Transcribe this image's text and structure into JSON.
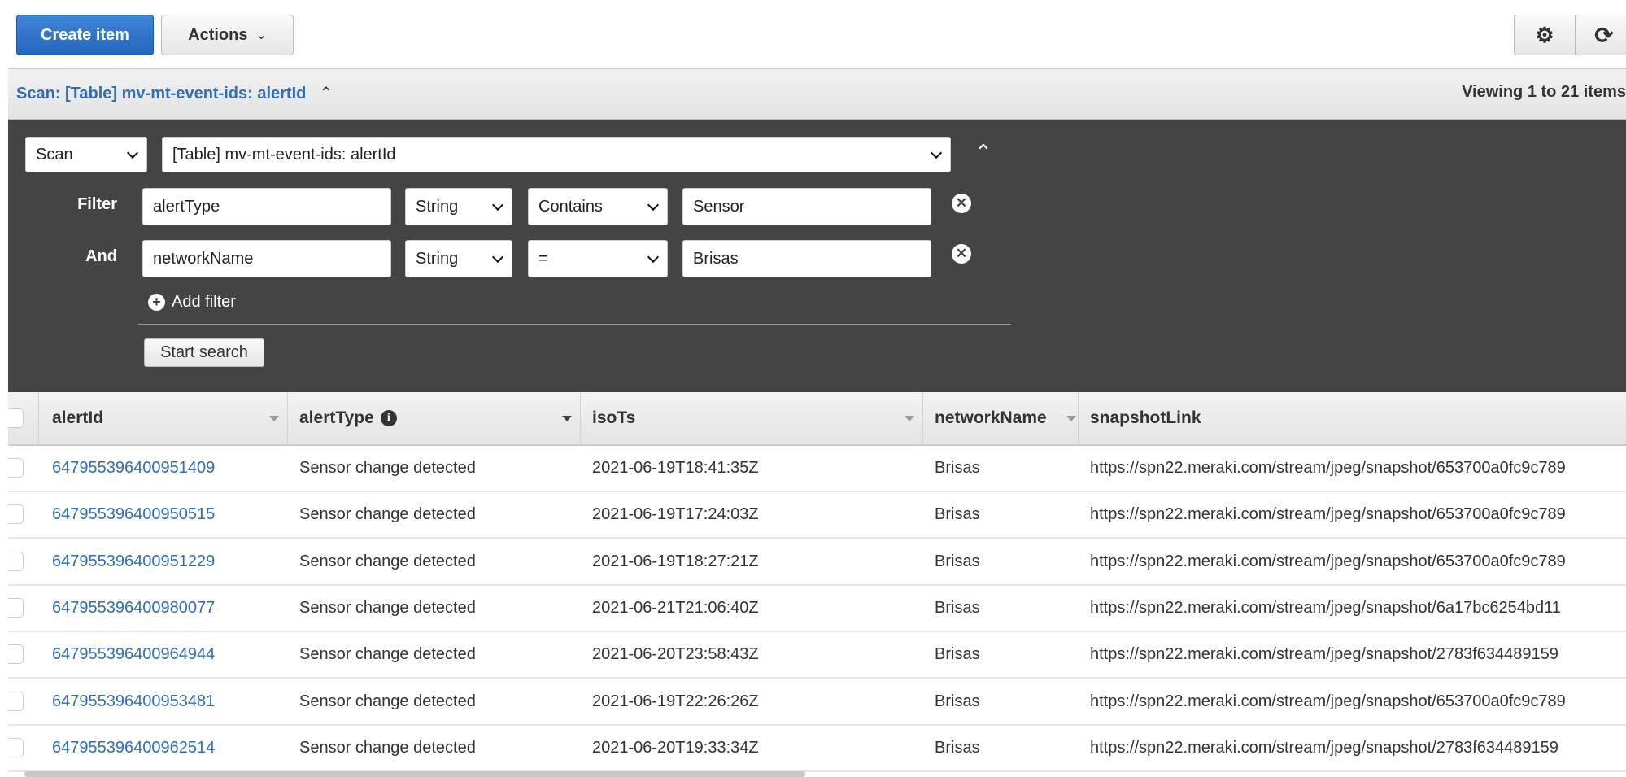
{
  "toolbar": {
    "create_label": "Create item",
    "actions_label": "Actions",
    "settings_icon": "gear-icon",
    "refresh_icon": "refresh-icon"
  },
  "scan_header": {
    "title": "Scan: [Table] mv-mt-event-ids: alertId",
    "viewing": "Viewing 1 to 21 items"
  },
  "query": {
    "mode": "Scan",
    "table": "[Table] mv-mt-event-ids: alertId",
    "filters": [
      {
        "label": "Filter",
        "attribute": "alertType",
        "type": "String",
        "operator": "Contains",
        "value": "Sensor"
      },
      {
        "label": "And",
        "attribute": "networkName",
        "type": "String",
        "operator": "=",
        "value": "Brisas"
      }
    ],
    "add_filter": "Add filter",
    "start_search": "Start search"
  },
  "table": {
    "columns": [
      "alertId",
      "alertType",
      "isoTs",
      "networkName",
      "snapshotLink"
    ],
    "rows": [
      [
        "647955396400951409",
        "Sensor change detected",
        "2021-06-19T18:41:35Z",
        "Brisas",
        "https://spn22.meraki.com/stream/jpeg/snapshot/653700a0fc9c789"
      ],
      [
        "647955396400950515",
        "Sensor change detected",
        "2021-06-19T17:24:03Z",
        "Brisas",
        "https://spn22.meraki.com/stream/jpeg/snapshot/653700a0fc9c789"
      ],
      [
        "647955396400951229",
        "Sensor change detected",
        "2021-06-19T18:27:21Z",
        "Brisas",
        "https://spn22.meraki.com/stream/jpeg/snapshot/653700a0fc9c789"
      ],
      [
        "647955396400980077",
        "Sensor change detected",
        "2021-06-21T21:06:40Z",
        "Brisas",
        "https://spn22.meraki.com/stream/jpeg/snapshot/6a17bc6254bd11"
      ],
      [
        "647955396400964944",
        "Sensor change detected",
        "2021-06-20T23:58:43Z",
        "Brisas",
        "https://spn22.meraki.com/stream/jpeg/snapshot/2783f634489159"
      ],
      [
        "647955396400953481",
        "Sensor change detected",
        "2021-06-19T22:26:26Z",
        "Brisas",
        "https://spn22.meraki.com/stream/jpeg/snapshot/653700a0fc9c789"
      ],
      [
        "647955396400962514",
        "Sensor change detected",
        "2021-06-20T19:33:34Z",
        "Brisas",
        "https://spn22.meraki.com/stream/jpeg/snapshot/2783f634489159"
      ]
    ]
  }
}
